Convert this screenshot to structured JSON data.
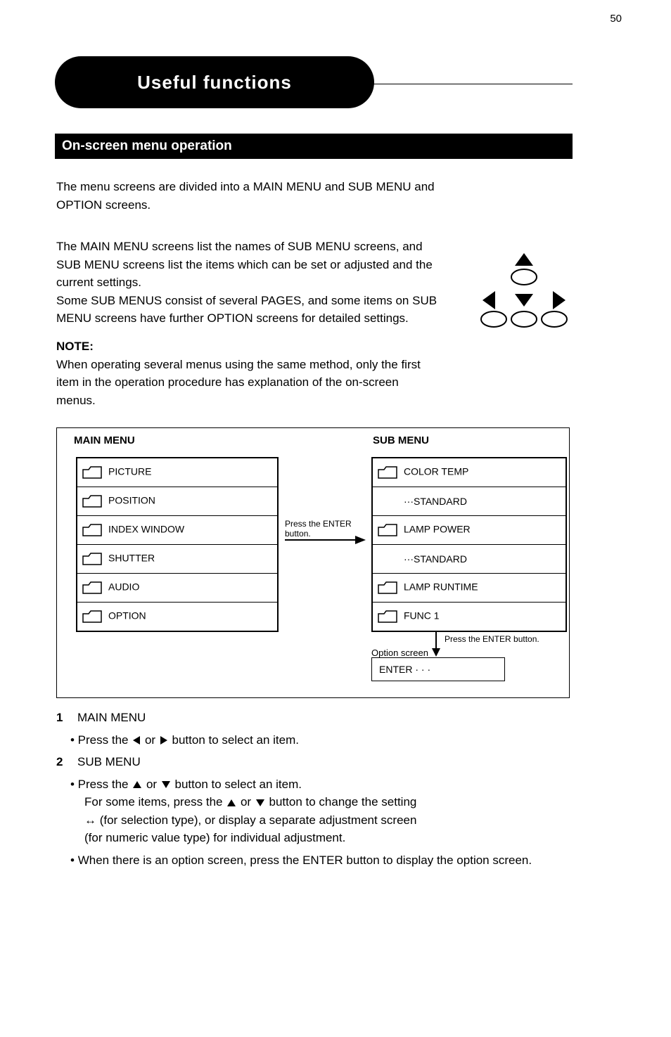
{
  "page_number": "50",
  "header_pill": "Useful functions",
  "section_bar": "On-screen menu operation",
  "intro_p1": "The menu screens are divided into a MAIN MENU and SUB MENU and OPTION screens.",
  "intro_p2": "The MAIN MENU screens list the names of SUB MENU screens, and SUB MENU screens list the items which can be set or adjusted and the current settings.",
  "intro_p3": "Some SUB MENUS consist of several PAGES, and some items on SUB MENU screens have further OPTION screens for detailed settings.",
  "note_label": "NOTE:",
  "note_p1": "When operating several menus using the same method, only the first item in the operation procedure has explanation of the on-screen menus.",
  "diagram": {
    "left_header": "MAIN MENU",
    "right_header": "SUB MENU",
    "left_items": [
      {
        "icon": "folder",
        "label": "PICTURE"
      },
      {
        "icon": "folder",
        "label": "POSITION"
      },
      {
        "icon": "folder",
        "label": "INDEX WINDOW"
      },
      {
        "icon": "folder",
        "label": "SHUTTER"
      },
      {
        "icon": "folder",
        "label": "AUDIO"
      },
      {
        "icon": "folder",
        "label": "OPTION"
      }
    ],
    "right_items": [
      {
        "icon": "folder",
        "label": "COLOR TEMP"
      },
      {
        "icon": "",
        "label": "···STANDARD"
      },
      {
        "icon": "folder",
        "label": "LAMP POWER"
      },
      {
        "icon": "",
        "label": "···STANDARD"
      },
      {
        "icon": "folder",
        "label": "LAMP RUNTIME"
      },
      {
        "icon": "folder",
        "label": "FUNC 1"
      }
    ],
    "arrow_right_label": "Press the ENTER button.",
    "arrow_down_label": "Press the ENTER button.",
    "enter_box_title": "Option screen",
    "enter_box_text": "ENTER · · ·"
  },
  "steps": {
    "s1": "MAIN MENU",
    "s1_b1": "Press the     or     button to select an item.",
    "s2": "SUB MENU",
    "s2_b1": "Press the     or     button to select an item.",
    "s2_b2": "When there is an option screen, press the ENTER button to display the option screen.",
    "s2_note1": "For some items, press the     or     button to change the setting",
    "s2_note2": "↔ (for selection type), or display a separate adjustment screen",
    "s2_note3": "(for numeric value type) for individual adjustment."
  }
}
